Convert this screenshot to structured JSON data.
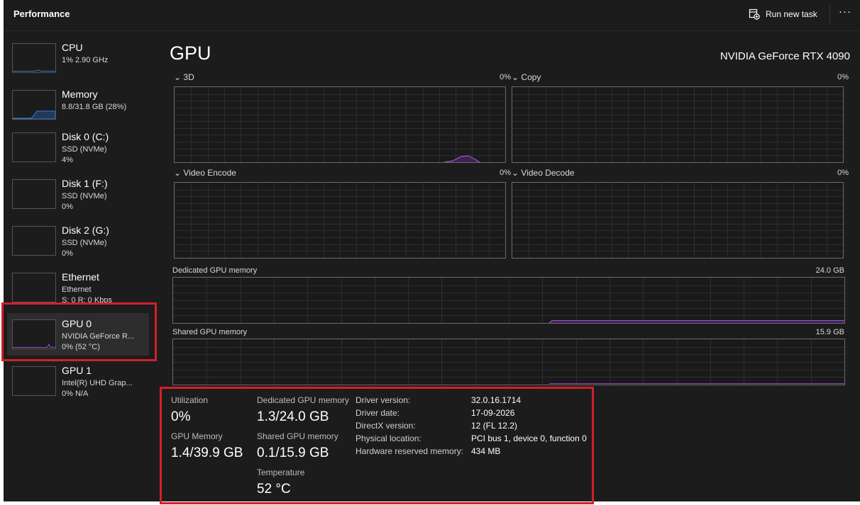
{
  "app": {
    "title": "Performance",
    "run_task_label": "Run new task",
    "more_label": "···"
  },
  "sidebar": {
    "items": [
      {
        "name": "CPU",
        "lines": [
          "1% 2.90 GHz"
        ]
      },
      {
        "name": "Memory",
        "lines": [
          "8.8/31.8 GB (28%)"
        ]
      },
      {
        "name": "Disk 0 (C:)",
        "lines": [
          "SSD (NVMe)",
          "4%"
        ]
      },
      {
        "name": "Disk 1 (F:)",
        "lines": [
          "SSD (NVMe)",
          "0%"
        ]
      },
      {
        "name": "Disk 2 (G:)",
        "lines": [
          "SSD (NVMe)",
          "0%"
        ]
      },
      {
        "name": "Ethernet",
        "lines": [
          "Ethernet",
          "S: 0 R: 0 Kbps"
        ]
      },
      {
        "name": "GPU 0",
        "lines": [
          "NVIDIA GeForce R...",
          "0% (52 °C)"
        ],
        "selected": true
      },
      {
        "name": "GPU 1",
        "lines": [
          "Intel(R) UHD Grap...",
          "0% N/A"
        ]
      }
    ]
  },
  "main": {
    "title": "GPU",
    "device_name": "NVIDIA GeForce RTX 4090",
    "engines": [
      {
        "label": "3D",
        "percent": "0%"
      },
      {
        "label": "Copy",
        "percent": "0%"
      },
      {
        "label": "Video Encode",
        "percent": "0%"
      },
      {
        "label": "Video Decode",
        "percent": "0%"
      }
    ],
    "memory_graphs": [
      {
        "label": "Dedicated GPU memory",
        "max": "24.0 GB",
        "fill_fraction": 0.054
      },
      {
        "label": "Shared GPU memory",
        "max": "15.9 GB",
        "fill_fraction": 0.006
      }
    ]
  },
  "stats": {
    "utilization": {
      "label": "Utilization",
      "value": "0%"
    },
    "gpu_memory": {
      "label": "GPU Memory",
      "value": "1.4/39.9 GB"
    },
    "dedicated": {
      "label": "Dedicated GPU memory",
      "value": "1.3/24.0 GB"
    },
    "shared": {
      "label": "Shared GPU memory",
      "value": "0.1/15.9 GB"
    },
    "temperature": {
      "label": "Temperature",
      "value": "52 °C"
    },
    "details": [
      {
        "label": "Driver version:",
        "value": "32.0.16.1714"
      },
      {
        "label": "Driver date:",
        "value": "17-09-2026"
      },
      {
        "label": "DirectX version:",
        "value": "12 (FL 12.2)"
      },
      {
        "label": "Physical location:",
        "value": "PCI bus 1, device 0, function 0"
      },
      {
        "label": "Hardware reserved memory:",
        "value": "434 MB"
      }
    ]
  },
  "colors": {
    "background": "#1c1c1c",
    "gpu_accent": "#9c4fd0",
    "memory_accent": "#3b7fc4",
    "cpu_accent": "#2b7fd6",
    "highlight": "#d0212a"
  }
}
